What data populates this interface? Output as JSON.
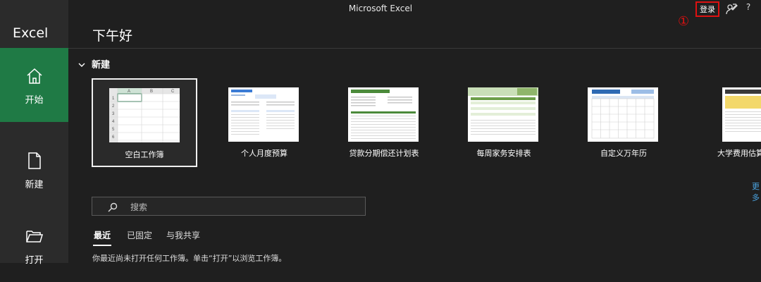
{
  "window": {
    "title": "Microsoft Excel"
  },
  "titlebar": {
    "signin_label": "登录",
    "annotation_marker": "①",
    "help_label": "?"
  },
  "sidebar": {
    "app_name": "Excel",
    "items": [
      {
        "label": "开始",
        "icon": "home-icon",
        "active": true
      },
      {
        "label": "新建",
        "icon": "new-file-icon",
        "active": false
      },
      {
        "label": "打开",
        "icon": "open-folder-icon",
        "active": false
      }
    ]
  },
  "main": {
    "greeting": "下午好",
    "new_section": {
      "title": "新建",
      "templates": [
        {
          "label": "空白工作簿",
          "selected": true
        },
        {
          "label": "个人月度预算",
          "selected": false
        },
        {
          "label": "贷款分期偿还计划表",
          "selected": false
        },
        {
          "label": "每周家务安排表",
          "selected": false
        },
        {
          "label": "自定义万年历",
          "selected": false
        },
        {
          "label": "大学费用估算",
          "selected": false
        }
      ],
      "more_link": "更多"
    },
    "search": {
      "placeholder": "搜索",
      "value": ""
    },
    "tabs": [
      {
        "label": "最近",
        "active": true
      },
      {
        "label": "已固定",
        "active": false
      },
      {
        "label": "与我共享",
        "active": false
      }
    ],
    "empty_message": "你最近尚未打开任何工作簿。单击“打开”以浏览工作簿。"
  },
  "colors": {
    "accent": "#1f7a45",
    "background": "#1f1f1f",
    "sidebar": "#2b2b2b",
    "annotation": "#dd1111"
  }
}
